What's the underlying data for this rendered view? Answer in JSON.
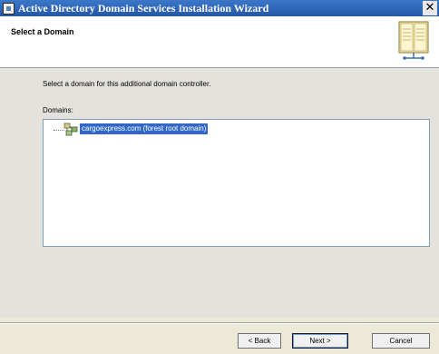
{
  "window": {
    "title": "Active Directory Domain Services Installation Wizard",
    "close_label": "✕"
  },
  "header": {
    "title": "Select a Domain",
    "art_icon": "directory-book-icon"
  },
  "main": {
    "instruction": "Select a domain for this additional domain controller.",
    "domains_label": "Domains:",
    "domains": [
      {
        "label": "cargoexpress.com (forest root domain)",
        "icon": "domain-tree-icon",
        "selected": true
      }
    ]
  },
  "footer": {
    "back_label": "< Back",
    "next_label": "Next >",
    "cancel_label": "Cancel"
  },
  "colors": {
    "titlebar": "#2f68b8",
    "selection": "#3168c6",
    "panel": "#e4e2dc"
  }
}
